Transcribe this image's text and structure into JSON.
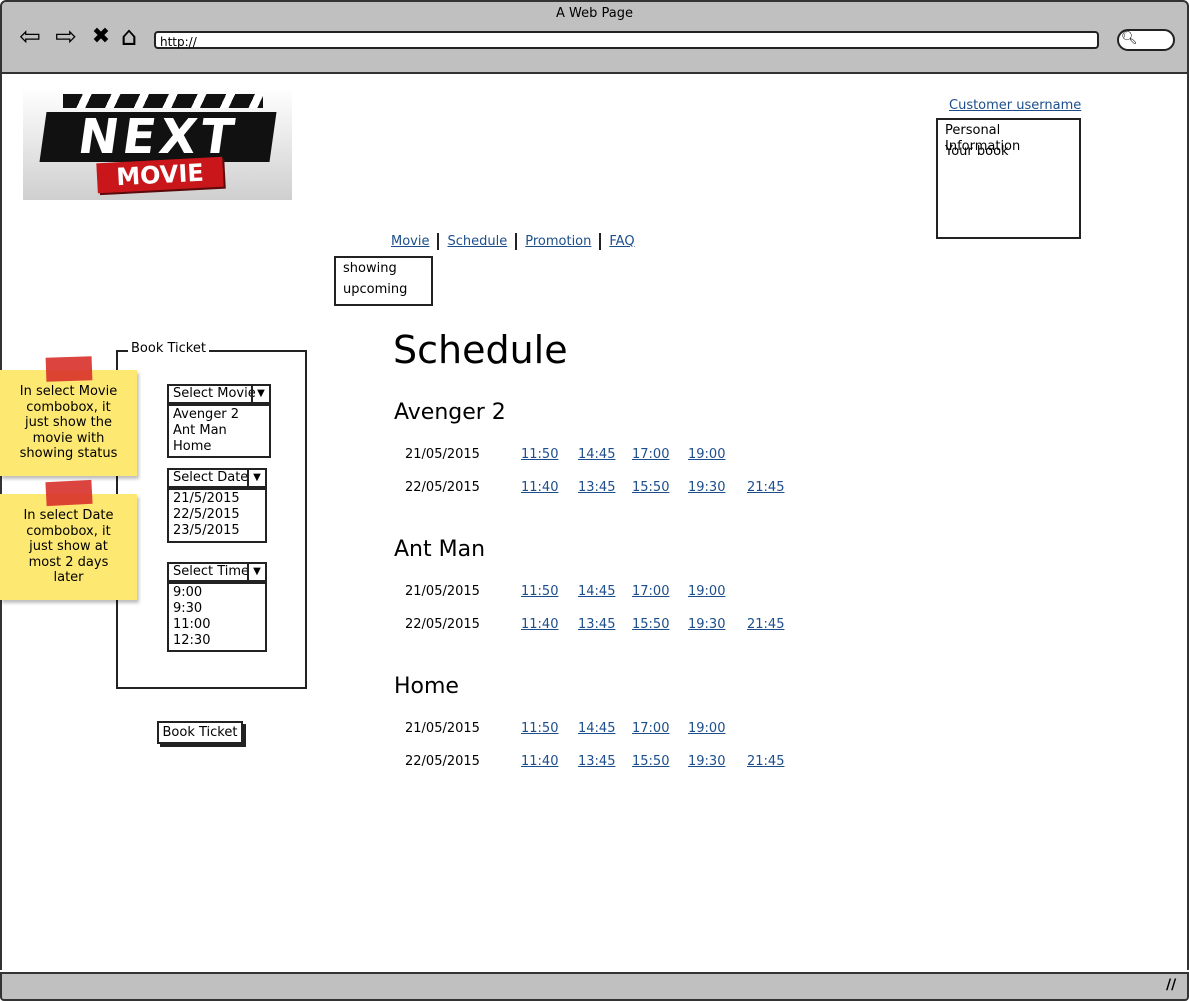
{
  "window": {
    "title": "A Web Page",
    "url": "http://"
  },
  "logo": {
    "line1": "NEXT",
    "line2": "MOVIE"
  },
  "user": {
    "link": "Customer username",
    "menu": [
      "Personal Information",
      "Your book"
    ]
  },
  "nav": {
    "items": [
      "Movie",
      "Schedule",
      "Promotion",
      "FAQ"
    ],
    "dropdown": [
      "showing",
      "upcoming"
    ]
  },
  "book": {
    "legend": "Book Ticket",
    "movie_combo": {
      "label": "Select Movie",
      "options": [
        "Avenger 2",
        "Ant Man",
        "Home"
      ]
    },
    "date_combo": {
      "label": "Select Date",
      "options": [
        "21/5/2015",
        "22/5/2015",
        "23/5/2015"
      ]
    },
    "time_combo": {
      "label": "Select Time",
      "options": [
        "9:00",
        "9:30",
        "11:00",
        "12:30"
      ]
    },
    "button": "Book Ticket"
  },
  "notes": [
    "In select Movie combobox, it just show the movie with showing status",
    "In select Date combobox, it just show at most 2 days later"
  ],
  "schedule": {
    "title": "Schedule",
    "movies": [
      {
        "name": "Avenger 2",
        "rows": [
          {
            "date": "21/05/2015",
            "times": [
              "11:50",
              "14:45",
              "17:00",
              "19:00"
            ]
          },
          {
            "date": "22/05/2015",
            "times": [
              "11:40",
              "13:45",
              "15:50",
              "19:30",
              "21:45"
            ]
          }
        ]
      },
      {
        "name": "Ant Man",
        "rows": [
          {
            "date": "21/05/2015",
            "times": [
              "11:50",
              "14:45",
              "17:00",
              "19:00"
            ]
          },
          {
            "date": "22/05/2015",
            "times": [
              "11:40",
              "13:45",
              "15:50",
              "19:30",
              "21:45"
            ]
          }
        ]
      },
      {
        "name": "Home",
        "rows": [
          {
            "date": "21/05/2015",
            "times": [
              "11:50",
              "14:45",
              "17:00",
              "19:00"
            ]
          },
          {
            "date": "22/05/2015",
            "times": [
              "11:40",
              "13:45",
              "15:50",
              "19:30",
              "21:45"
            ]
          }
        ]
      }
    ]
  }
}
